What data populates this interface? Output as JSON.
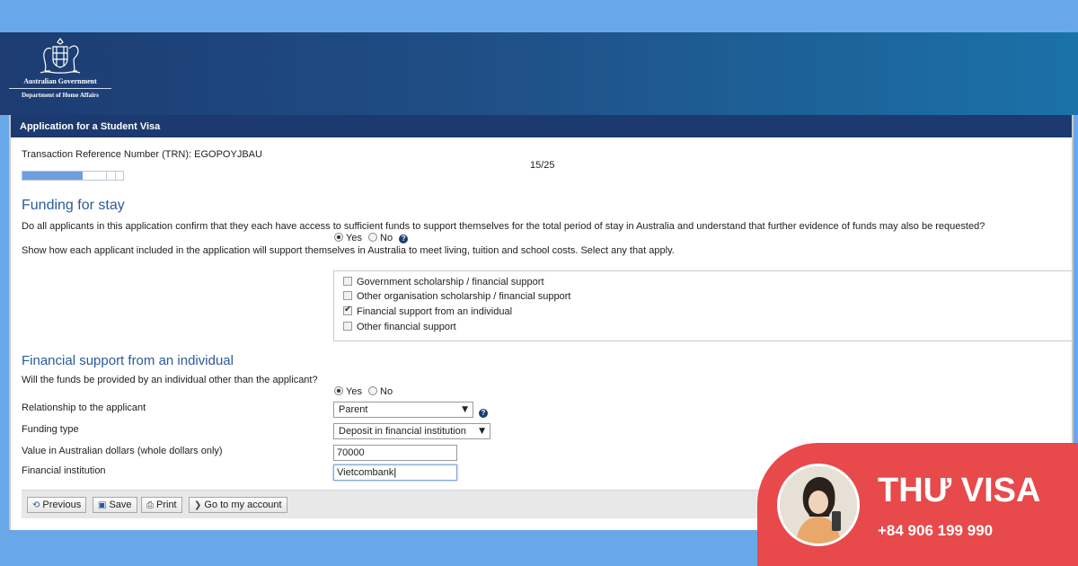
{
  "header": {
    "gov_name": "Australian Government",
    "department": "Department of Home Affairs",
    "app_title": "Application for a Student Visa"
  },
  "trn_label": "Transaction Reference Number (TRN): EGOPOYJBAU",
  "progress": {
    "text": "15/25",
    "fraction": 0.6
  },
  "funding": {
    "heading": "Funding for stay",
    "question": "Do all applicants in this application confirm that they each have access to sufficient funds to support themselves for the total period of stay in Australia and understand that further evidence of funds may also be requested?",
    "yes": "Yes",
    "no": "No",
    "selected": "Yes",
    "instruction": "Show how each applicant included in the application will support themselves in Australia to meet living, tuition and school costs. Select any that apply.",
    "options": [
      {
        "label": "Government scholarship / financial support",
        "checked": false
      },
      {
        "label": "Other organisation scholarship / financial support",
        "checked": false
      },
      {
        "label": "Financial support from an individual",
        "checked": true
      },
      {
        "label": "Other financial support",
        "checked": false
      }
    ]
  },
  "individual": {
    "heading": "Financial support from an individual",
    "question": "Will the funds be provided by an individual other than the applicant?",
    "yes": "Yes",
    "no": "No",
    "selected": "Yes",
    "relationship_label": "Relationship to the applicant",
    "relationship_value": "Parent",
    "funding_type_label": "Funding type",
    "funding_type_value": "Deposit in financial institution",
    "value_label": "Value in Australian dollars (whole dollars only)",
    "value": "70000",
    "institution_label": "Financial institution",
    "institution_value": "Vietcombank"
  },
  "toolbar": {
    "previous": "Previous",
    "save": "Save",
    "print": "Print",
    "account": "Go to my account"
  },
  "brand": {
    "name": "THƯ VISA",
    "phone": "+84 906 199 990"
  },
  "colors": {
    "background": "#68a7e8",
    "banner": "#1c3c72",
    "title_bar": "#1c3a70",
    "heading": "#2a5b9a",
    "brand": "#e8494a"
  }
}
